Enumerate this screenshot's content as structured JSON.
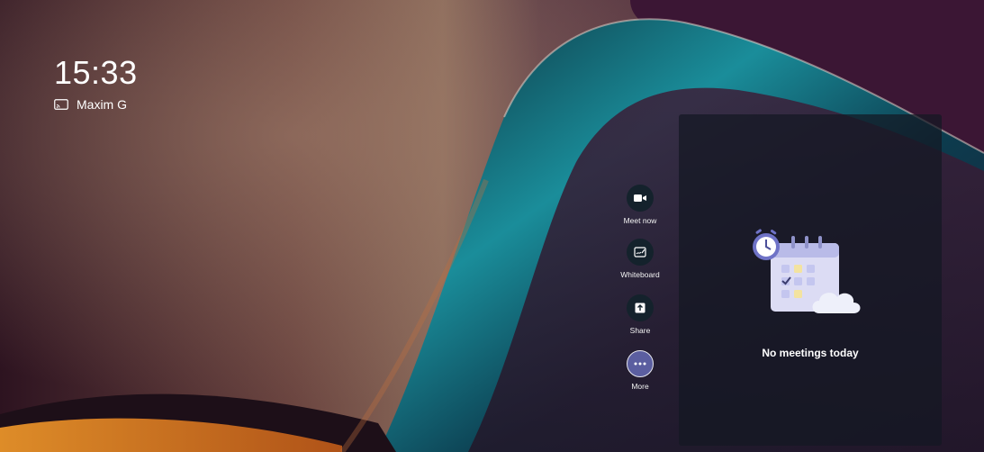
{
  "clock": {
    "time": "15:33"
  },
  "device": {
    "name": "Maxim G",
    "icon": "cast-icon"
  },
  "actions": [
    {
      "label": "Meet now",
      "icon": "video-camera-icon"
    },
    {
      "label": "Whiteboard",
      "icon": "whiteboard-icon"
    },
    {
      "label": "Share",
      "icon": "share-icon"
    },
    {
      "label": "More",
      "icon": "more-icon"
    }
  ],
  "panel": {
    "empty_message": "No meetings today",
    "illustration": "calendar-clock-cloud-illustration"
  },
  "colors": {
    "button_bg": "#14222c",
    "more_bg": "#5b5ea0",
    "panel_bg": "#141822"
  }
}
